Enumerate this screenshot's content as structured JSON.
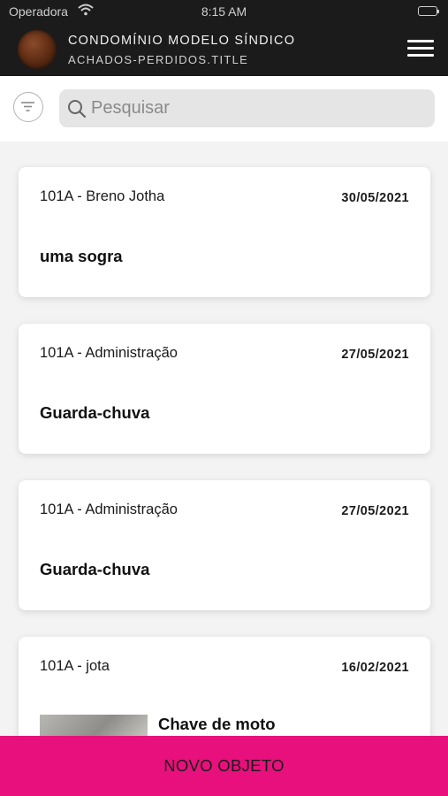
{
  "status_bar": {
    "carrier": "Operadora",
    "time": "8:15 AM",
    "battery_level": 1.0
  },
  "header": {
    "title": "CONDOMÍNIO MODELO SÍNDICO",
    "subtitle": "ACHADOS-PERDIDOS.TITLE"
  },
  "search": {
    "placeholder": "Pesquisar",
    "value": ""
  },
  "items": [
    {
      "owner": "101A - Breno Jotha",
      "date": "30/05/2021",
      "item": "uma sogra",
      "has_image": false
    },
    {
      "owner": "101A - Administração",
      "date": "27/05/2021",
      "item": "Guarda-chuva",
      "has_image": false
    },
    {
      "owner": "101A - Administração",
      "date": "27/05/2021",
      "item": "Guarda-chuva",
      "has_image": false
    },
    {
      "owner": "101A - jota",
      "date": "16/02/2021",
      "item": "Chave de moto",
      "has_image": true
    }
  ],
  "bottom_button": {
    "label": "NOVO OBJETO"
  },
  "colors": {
    "accent": "#e8107c",
    "header_bg": "#1b1b1b",
    "page_bg": "#f3f3f3"
  }
}
